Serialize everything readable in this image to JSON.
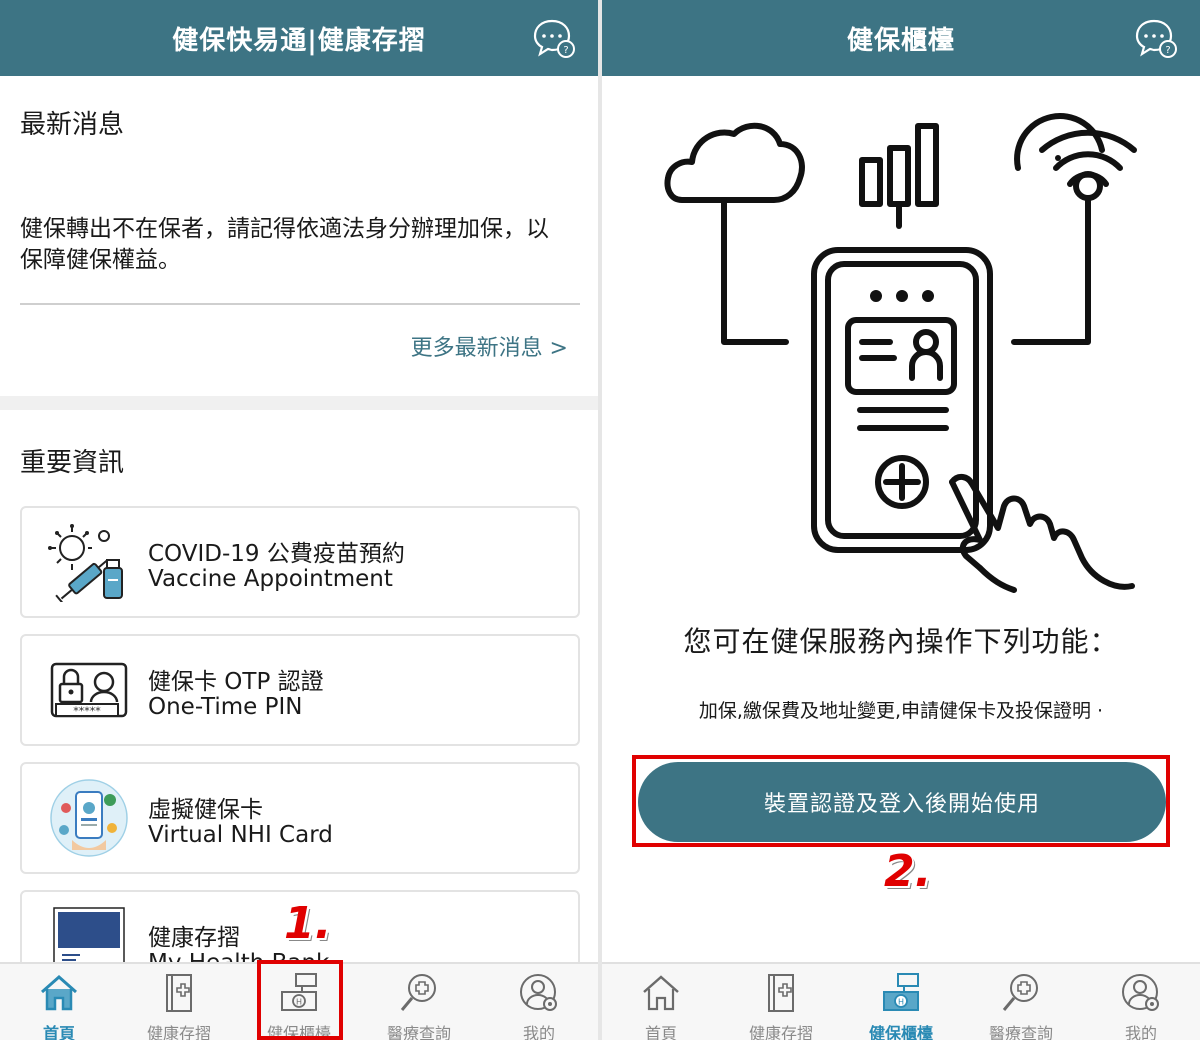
{
  "left": {
    "header": {
      "title": "健保快易通|健康存摺"
    },
    "news": {
      "section_title": "最新消息",
      "item_text": "健保轉出不在保者，請記得依適法身分辦理加保，以保障健保權益。",
      "more_link": "更多最新消息 >"
    },
    "important": {
      "section_title": "重要資訊",
      "cards": [
        {
          "line1": "COVID-19 公費疫苗預約",
          "line2": "Vaccine Appointment",
          "icon": "vaccine-icon"
        },
        {
          "line1": "健保卡 OTP 認證",
          "line2": "One-Time PIN",
          "icon": "otp-lock-icon"
        },
        {
          "line1": "虛擬健保卡",
          "line2": "Virtual NHI Card",
          "icon": "virtual-card-icon"
        },
        {
          "line1": "健康存摺",
          "line2": "My Health Bank",
          "icon": "health-bank-book-icon"
        }
      ]
    },
    "tabs": [
      {
        "label": "首頁",
        "icon": "home-icon"
      },
      {
        "label": "健康存摺",
        "icon": "health-book-icon"
      },
      {
        "label": "健保櫃檯",
        "icon": "counter-icon"
      },
      {
        "label": "醫療查詢",
        "icon": "medical-search-icon"
      },
      {
        "label": "我的",
        "icon": "user-settings-icon"
      }
    ],
    "active_tab": "首頁",
    "annotation": "1."
  },
  "right": {
    "header": {
      "title": "健保櫃檯"
    },
    "function_title": "您可在健保服務內操作下列功能：",
    "function_desc": "加保,繳保費及地址變更,申請健保卡及投保證明 ·",
    "start_button": "裝置認證及登入後開始使用",
    "tabs": [
      {
        "label": "首頁",
        "icon": "home-icon"
      },
      {
        "label": "健康存摺",
        "icon": "health-book-icon"
      },
      {
        "label": "健保櫃檯",
        "icon": "counter-icon"
      },
      {
        "label": "醫療查詢",
        "icon": "medical-search-icon"
      },
      {
        "label": "我的",
        "icon": "user-settings-icon"
      }
    ],
    "active_tab": "健保櫃檯",
    "annotation": "2."
  },
  "colors": {
    "header": "#3d7484",
    "active_tab": "#2a8ab4",
    "inactive_tab": "#8a8a8a",
    "link": "#3d7484",
    "annotation": "#e00000",
    "icon_blue": "#5aa7c8"
  }
}
